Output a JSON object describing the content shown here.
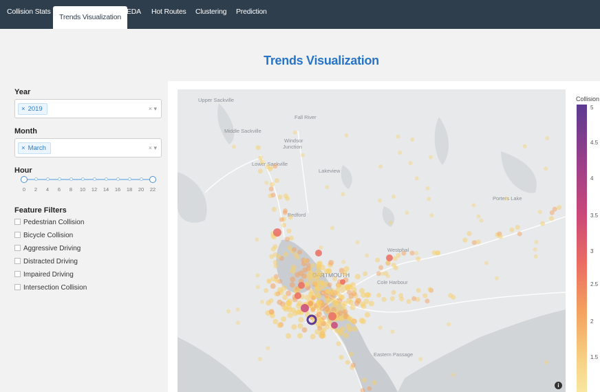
{
  "nav": {
    "tabs": [
      {
        "label": "Collision Stats"
      },
      {
        "label": "Trends Visualization",
        "active": true
      },
      {
        "label": "EDA"
      },
      {
        "label": "Hot Routes"
      },
      {
        "label": "Clustering"
      },
      {
        "label": "Prediction"
      }
    ]
  },
  "page": {
    "title": "Trends Visualization"
  },
  "filters": {
    "year": {
      "label": "Year",
      "selected": "2019"
    },
    "month": {
      "label": "Month",
      "selected": "March"
    },
    "hour": {
      "label": "Hour",
      "range": [
        0,
        22
      ],
      "ticks": [
        "0",
        "2",
        "4",
        "6",
        "8",
        "10",
        "12",
        "14",
        "16",
        "18",
        "20",
        "22"
      ]
    },
    "features": {
      "label": "Feature Filters",
      "items": [
        "Pedestrian Collision",
        "Bicycle Collision",
        "Aggressive Driving",
        "Distracted Driving",
        "Impaired Driving",
        "Intersection Collision"
      ]
    }
  },
  "map": {
    "place_labels": [
      "Upper Sackville",
      "Fall River",
      "Middle Sackville",
      "Windsor Junction",
      "Lower Sackville",
      "Lakeview",
      "Bedford",
      "DARTMOUTH",
      "Westphal",
      "Cole Harbour",
      "Eastern Passage",
      "Porters Lake"
    ],
    "colorbar": {
      "title": "Collision",
      "ticks": [
        "5",
        "4.5",
        "4",
        "3.5",
        "3",
        "2.5",
        "2",
        "1.5"
      ],
      "colors": [
        "#5b3a91",
        "#c9487a",
        "#f4a25f",
        "#f8e6a0"
      ]
    }
  }
}
